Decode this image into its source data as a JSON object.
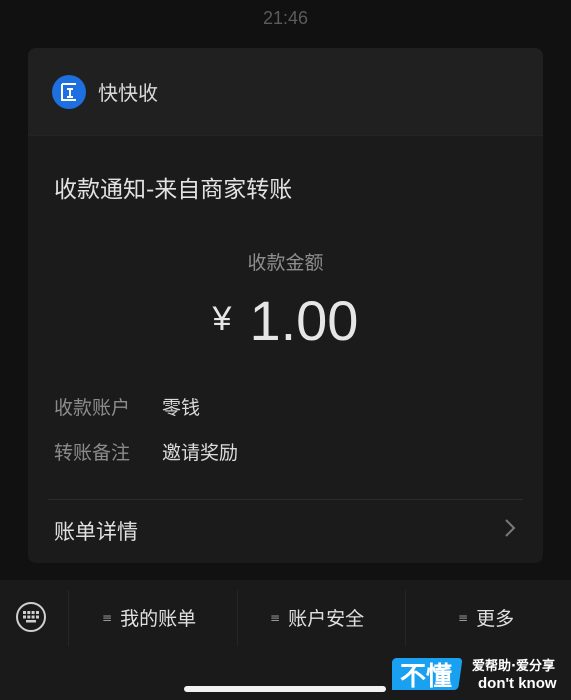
{
  "status": {
    "time": "21:46"
  },
  "card": {
    "app_name": "快快收",
    "title": "收款通知-来自商家转账",
    "amount_label": "收款金额",
    "currency": "¥",
    "amount": "1.00",
    "rows": [
      {
        "key": "收款账户",
        "value": "零钱"
      },
      {
        "key": "转账备注",
        "value": "邀请奖励"
      }
    ],
    "detail_label": "账单详情",
    "app_icon": "kuaikuaishou-logo"
  },
  "bottom_menu": {
    "items": [
      {
        "label": "我的账单"
      },
      {
        "label": "账户安全"
      },
      {
        "label": "更多"
      }
    ]
  },
  "watermark": {
    "logo_text": "不懂",
    "line1": "爱帮助·爱分享",
    "line2": "don't know"
  },
  "colors": {
    "background": "#111111",
    "card": "#1b1b1b",
    "app_icon": "#1e6fe0"
  }
}
